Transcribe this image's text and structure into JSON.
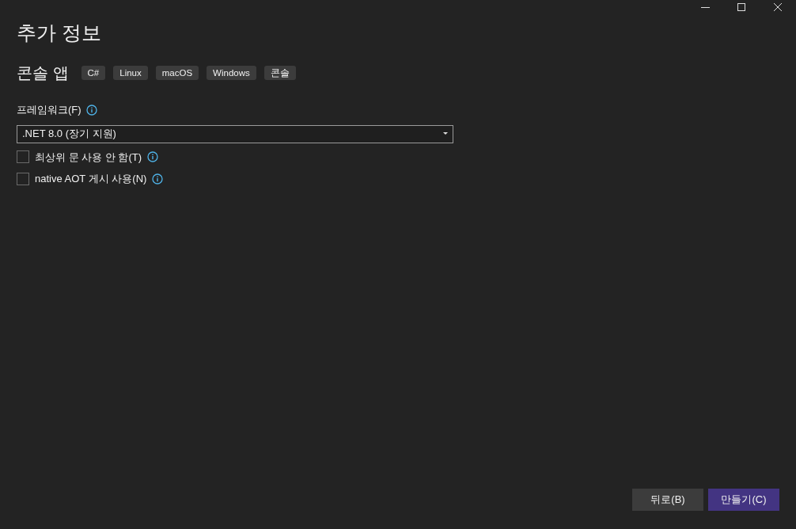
{
  "title": "추가 정보",
  "template": {
    "name": "콘솔 앱",
    "tags": [
      "C#",
      "Linux",
      "macOS",
      "Windows",
      "콘솔"
    ]
  },
  "framework": {
    "label": "프레임워크(F)",
    "value": ".NET 8.0 (장기 지원)"
  },
  "options": [
    {
      "label": "최상위 문 사용 안 함(T)",
      "checked": false
    },
    {
      "label": "native AOT 게시 사용(N)",
      "checked": false
    }
  ],
  "buttons": [
    {
      "label": "뒤로(B)",
      "kind": "secondary"
    },
    {
      "label": "만들기(C)",
      "kind": "primary"
    }
  ]
}
